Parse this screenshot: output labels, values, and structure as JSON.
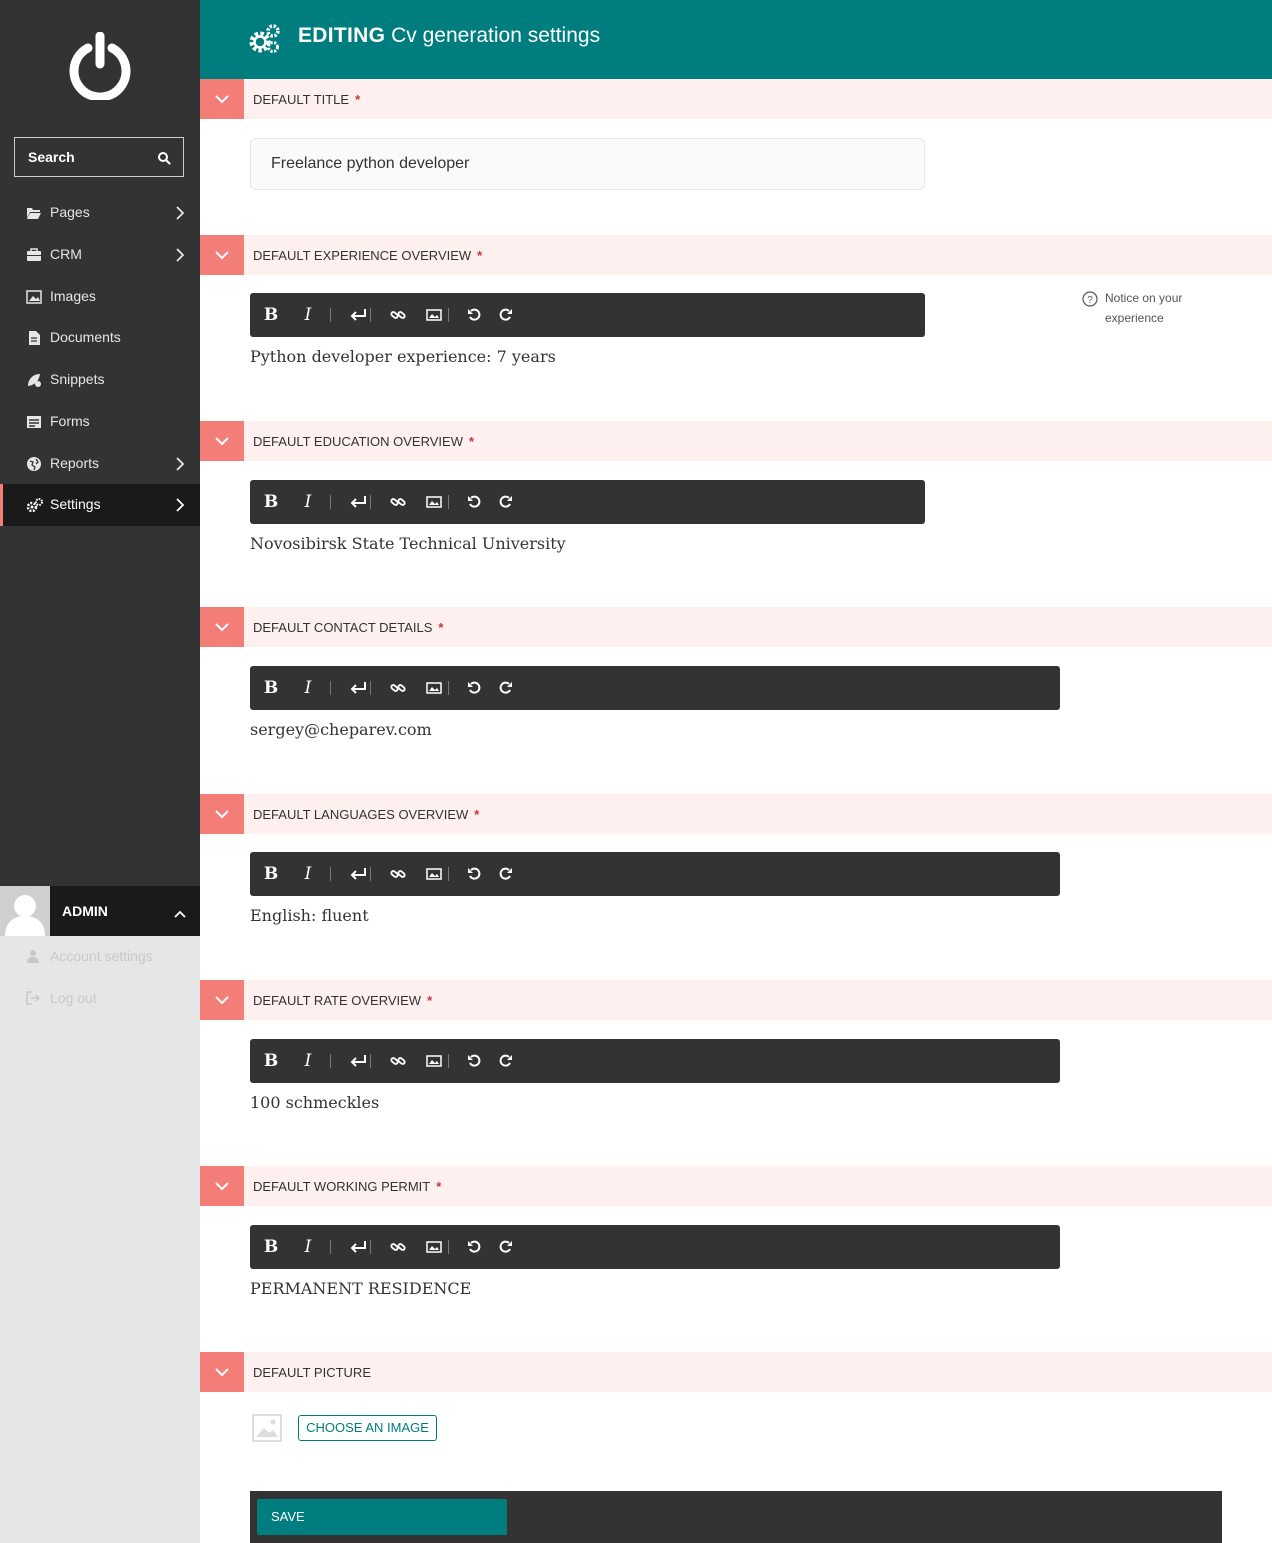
{
  "sidebar": {
    "search_placeholder": "Search",
    "items": [
      {
        "label": "Pages",
        "icon": "folder-open-icon"
      },
      {
        "label": "CRM",
        "icon": "briefcase-icon"
      },
      {
        "label": "Images",
        "icon": "image-icon"
      },
      {
        "label": "Documents",
        "icon": "document-icon"
      },
      {
        "label": "Snippets",
        "icon": "snippet-icon"
      },
      {
        "label": "Forms",
        "icon": "form-icon"
      },
      {
        "label": "Reports",
        "icon": "globe-icon"
      },
      {
        "label": "Settings",
        "icon": "cogs-icon",
        "active": true
      }
    ],
    "account": {
      "username": "ADMIN",
      "account_settings": "Account settings",
      "log_out": "Log out"
    }
  },
  "header": {
    "action": "EDITING",
    "title": "Cv generation settings"
  },
  "fields": {
    "title": {
      "label": "DEFAULT TITLE",
      "required": "*",
      "value": "Freelance python developer"
    },
    "experience": {
      "label": "DEFAULT EXPERIENCE OVERVIEW",
      "required": "*",
      "value": "Python developer experience: 7 years",
      "help": "Notice on your experience"
    },
    "education": {
      "label": "DEFAULT EDUCATION OVERVIEW",
      "required": "*",
      "value": "Novosibirsk State Technical University"
    },
    "contact": {
      "label": "DEFAULT CONTACT DETAILS",
      "required": "*",
      "value": "sergey@cheparev.com"
    },
    "languages": {
      "label": "DEFAULT LANGUAGES OVERVIEW",
      "required": "*",
      "value": "English: fluent"
    },
    "rate": {
      "label": "DEFAULT RATE OVERVIEW",
      "required": "*",
      "value": "100 schmeckles"
    },
    "permit": {
      "label": "DEFAULT WORKING PERMIT",
      "required": "*",
      "value": "PERMANENT RESIDENCE"
    },
    "picture": {
      "label": "DEFAULT PICTURE",
      "choose_label": "CHOOSE AN IMAGE"
    }
  },
  "toolbar": {
    "bold": "B",
    "italic": "I"
  },
  "footer": {
    "save_label": "SAVE"
  },
  "colors": {
    "brand": "#007d7e",
    "accent": "#f37e77",
    "sidebar": "#333333",
    "section_bg": "#fdf0ee"
  }
}
